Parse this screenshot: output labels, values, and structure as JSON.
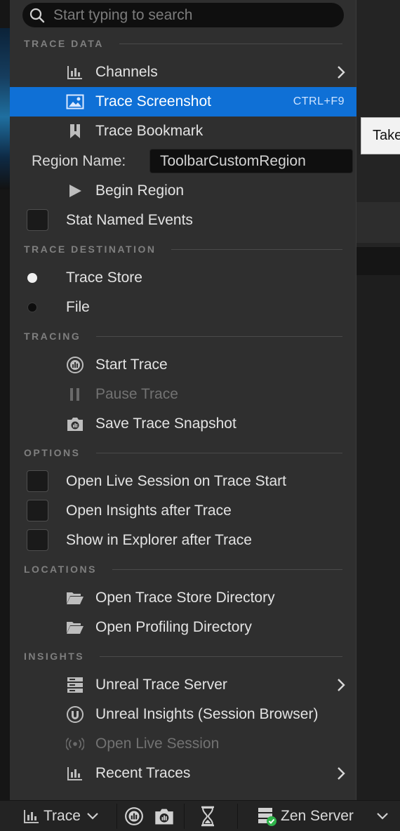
{
  "search": {
    "placeholder": "Start typing to search"
  },
  "tooltip": {
    "text": "Take"
  },
  "sections": {
    "trace_data": "TRACE DATA",
    "trace_destination": "TRACE DESTINATION",
    "tracing": "TRACING",
    "options": "OPTIONS",
    "locations": "LOCATIONS",
    "insights": "INSIGHTS"
  },
  "trace_data": {
    "channels": "Channels",
    "trace_screenshot": "Trace Screenshot",
    "trace_screenshot_shortcut": "CTRL+F9",
    "trace_bookmark": "Trace Bookmark",
    "region_name_label": "Region Name:",
    "region_name_value": "ToolbarCustomRegion",
    "begin_region": "Begin Region",
    "stat_named_events": "Stat Named Events",
    "stat_named_events_checked": false
  },
  "trace_destination": {
    "trace_store": "Trace Store",
    "file": "File",
    "selected": "Trace Store"
  },
  "tracing": {
    "start_trace": "Start Trace",
    "pause_trace": "Pause Trace",
    "save_trace_snapshot": "Save Trace Snapshot"
  },
  "options": {
    "open_live_session": "Open Live Session on Trace Start",
    "open_insights": "Open Insights after Trace",
    "show_in_explorer": "Show in Explorer after Trace"
  },
  "locations": {
    "open_trace_store_dir": "Open Trace Store Directory",
    "open_profiling_dir": "Open Profiling Directory"
  },
  "insights": {
    "unreal_trace_server": "Unreal Trace Server",
    "unreal_insights": "Unreal Insights (Session Browser)",
    "open_live_session": "Open Live Session",
    "recent_traces": "Recent Traces"
  },
  "toolbar": {
    "trace_label": "Trace",
    "zen_server_label": "Zen Server"
  },
  "colors": {
    "menu_bg": "#2f2f2f",
    "selection": "#0f70d6",
    "section_text": "#7f7f7f",
    "disabled_text": "#727272",
    "zen_status": "#2fb34a"
  }
}
